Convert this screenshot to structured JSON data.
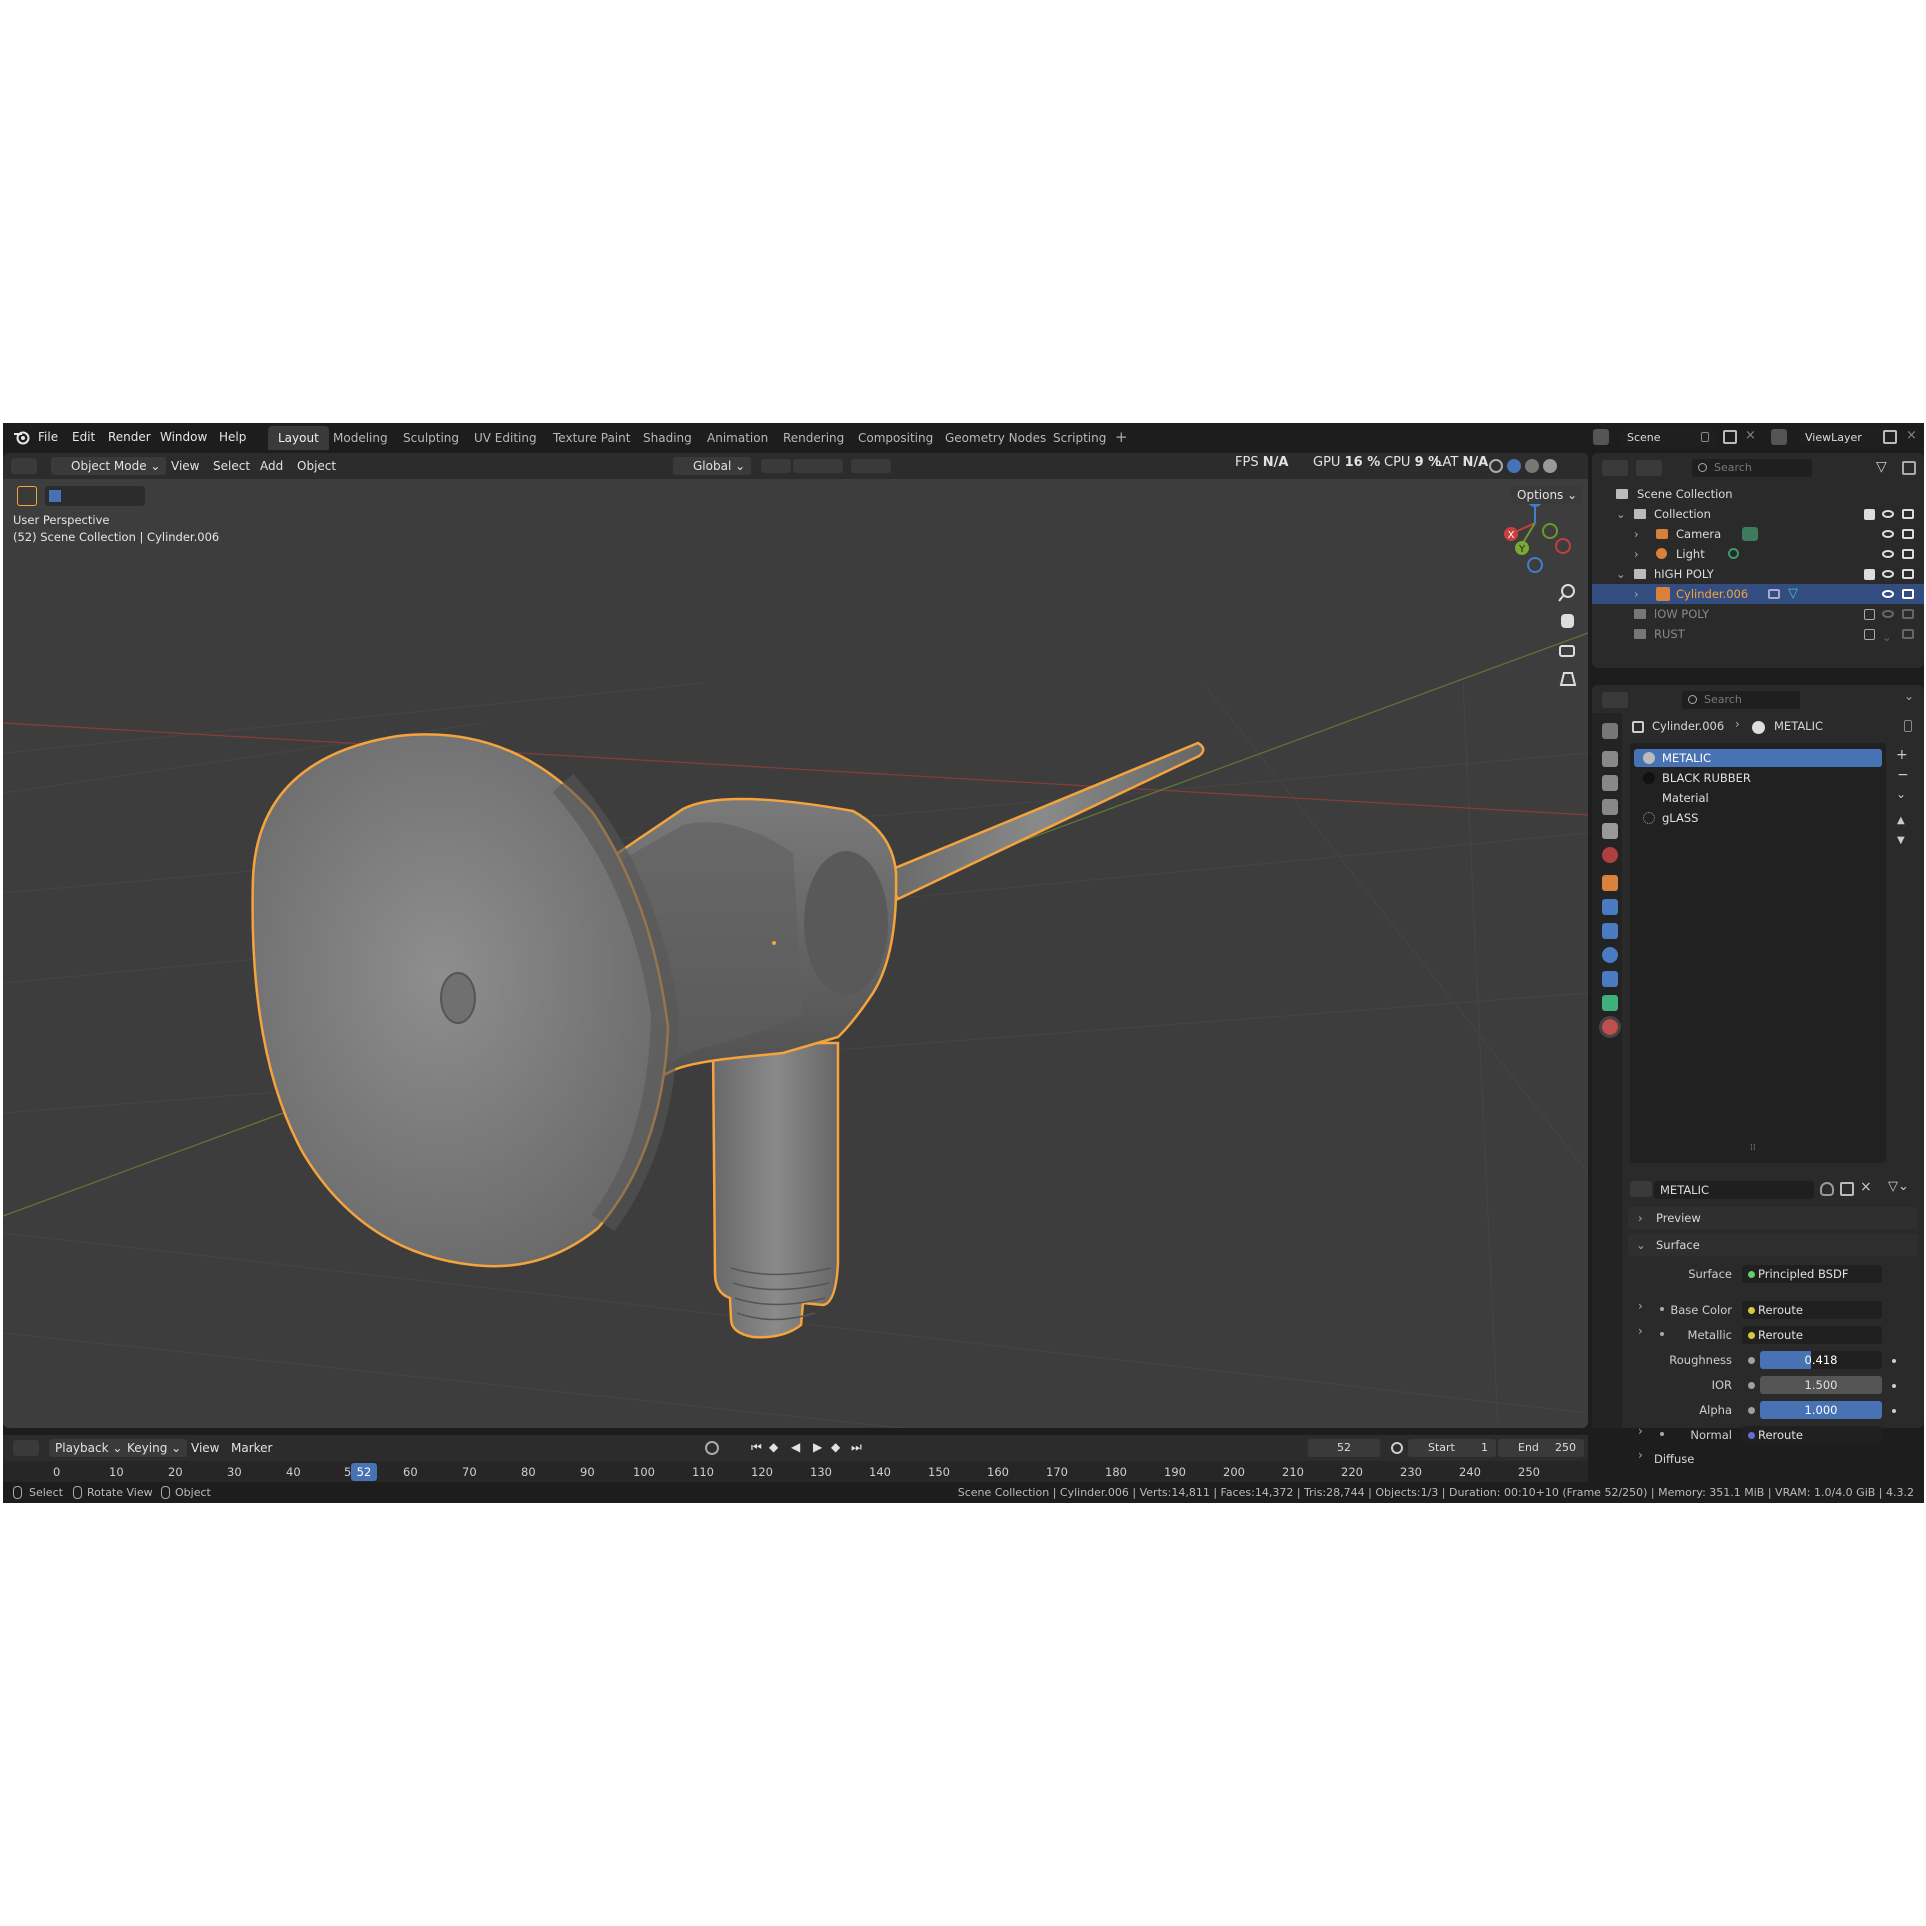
{
  "menu": [
    "File",
    "Edit",
    "Render",
    "Window",
    "Help"
  ],
  "workspaces": [
    "Layout",
    "Modeling",
    "Sculpting",
    "UV Editing",
    "Texture Paint",
    "Shading",
    "Animation",
    "Rendering",
    "Compositing",
    "Geometry Nodes",
    "Scripting"
  ],
  "scene_name": "Scene",
  "view_layer": "ViewLayer",
  "viewport": {
    "mode": "Object Mode",
    "menus": [
      "View",
      "Select",
      "Add",
      "Object"
    ],
    "orientation": "Global",
    "options": "Options",
    "overlay_title": "User Perspective",
    "overlay_sub": "(52) Scene Collection | Cylinder.006",
    "stats": {
      "fps_label": "FPS",
      "fps": "N/A",
      "gpu_label": "GPU",
      "gpu": "16 %",
      "cpu_label": "CPU",
      "cpu": "9 %",
      "lat_label": "LAT",
      "lat": "N/A"
    },
    "gizmo": {
      "z": "Z",
      "x": "X",
      "y": "Y"
    }
  },
  "outliner": {
    "search_placeholder": "Search",
    "rows": [
      {
        "label": "Scene Collection"
      },
      {
        "label": "Collection"
      },
      {
        "label": "Camera"
      },
      {
        "label": "Light"
      },
      {
        "label": "hIGH POLY"
      },
      {
        "label": "Cylinder.006"
      },
      {
        "label": "lOW POLY"
      },
      {
        "label": "RUST"
      }
    ]
  },
  "properties": {
    "search_placeholder": "Search",
    "breadcrumb_object": "Cylinder.006",
    "breadcrumb_material": "METALIC",
    "material_slots": [
      "METALIC",
      "BLACK RUBBER",
      "Material",
      "gLASS"
    ],
    "material_name": "METALIC",
    "panels": {
      "preview": "Preview",
      "surface": "Surface",
      "diffuse": "Diffuse"
    },
    "surface_rows": [
      {
        "label": "Surface",
        "value": "Principled BSDF"
      },
      {
        "label": "Base Color",
        "value": "Reroute"
      },
      {
        "label": "Metallic",
        "value": "Reroute"
      },
      {
        "label": "Roughness",
        "value": "0.418"
      },
      {
        "label": "IOR",
        "value": "1.500"
      },
      {
        "label": "Alpha",
        "value": "1.000"
      },
      {
        "label": "Normal",
        "value": "Reroute"
      }
    ]
  },
  "timeline": {
    "menus": [
      "Playback",
      "Keying",
      "View",
      "Marker"
    ],
    "current_frame": "52",
    "start_label": "Start",
    "start": "1",
    "end_label": "End",
    "end": "250",
    "ticks": [
      "0",
      "10",
      "20",
      "30",
      "40",
      "5",
      "60",
      "70",
      "80",
      "90",
      "100",
      "110",
      "120",
      "130",
      "140",
      "150",
      "160",
      "170",
      "180",
      "190",
      "200",
      "210",
      "220",
      "230",
      "240",
      "250"
    ]
  },
  "status": {
    "select": "Select",
    "rotate": "Rotate View",
    "object": "Object",
    "info": "Scene Collection | Cylinder.006 | Verts:14,811 | Faces:14,372 | Tris:28,744 | Objects:1/3 | Duration: 00:10+10 (Frame 52/250) | Memory: 351.1 MiB | VRAM: 1.0/4.0 GiB | 4.3.2"
  },
  "colors": {
    "accent": "#4772b3",
    "selection": "#f5a33c",
    "bg": "#1d1d1d",
    "viewport": "#3d3d3d"
  }
}
